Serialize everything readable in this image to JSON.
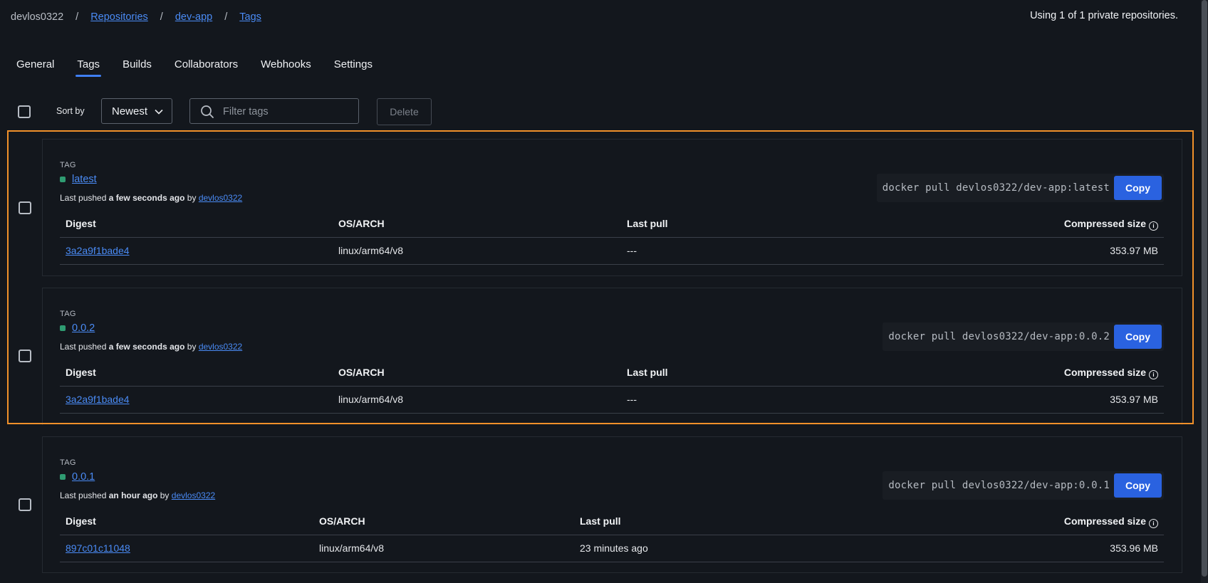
{
  "breadcrumb": {
    "user": "devlos0322",
    "repositories": "Repositories",
    "repo": "dev-app",
    "tags": "Tags",
    "separator": "/"
  },
  "usage_text": "Using 1 of 1 private repositories.",
  "tabs": [
    {
      "label": "General"
    },
    {
      "label": "Tags",
      "active": true
    },
    {
      "label": "Builds"
    },
    {
      "label": "Collaborators"
    },
    {
      "label": "Webhooks"
    },
    {
      "label": "Settings"
    }
  ],
  "toolbar": {
    "sort_label": "Sort by",
    "sort_value": "Newest",
    "filter_placeholder": "Filter tags",
    "delete_label": "Delete"
  },
  "table_headers": {
    "digest": "Digest",
    "os_arch": "OS/ARCH",
    "last_pull": "Last pull",
    "size": "Compressed size"
  },
  "tags": [
    {
      "label": "TAG",
      "name": "latest",
      "pushed_prefix": "Last pushed",
      "pushed_time": "a few seconds ago",
      "pushed_by_word": "by",
      "pushed_by": "devlos0322",
      "pull_command": "docker pull devlos0322/dev-app:latest",
      "copy_label": "Copy",
      "row": {
        "digest": "3a2a9f1bade4",
        "os_arch": "linux/arm64/v8",
        "last_pull": "---",
        "size": "353.97 MB"
      }
    },
    {
      "label": "TAG",
      "name": "0.0.2",
      "pushed_prefix": "Last pushed",
      "pushed_time": "a few seconds ago",
      "pushed_by_word": "by",
      "pushed_by": "devlos0322",
      "pull_command": "docker pull devlos0322/dev-app:0.0.2",
      "copy_label": "Copy",
      "row": {
        "digest": "3a2a9f1bade4",
        "os_arch": "linux/arm64/v8",
        "last_pull": "---",
        "size": "353.97 MB"
      }
    },
    {
      "label": "TAG",
      "name": "0.0.1",
      "pushed_prefix": "Last pushed",
      "pushed_time": "an hour ago",
      "pushed_by_word": "by",
      "pushed_by": "devlos0322",
      "pull_command": "docker pull devlos0322/dev-app:0.0.1",
      "copy_label": "Copy",
      "row": {
        "digest": "897c01c11048",
        "os_arch": "linux/arm64/v8",
        "last_pull": "23 minutes ago",
        "size": "353.96 MB"
      }
    }
  ],
  "colors": {
    "background": "#13171d",
    "link": "#4a8bf5",
    "accent": "#3f7ff2",
    "copy_button": "#2a62e0",
    "highlight": "#f0902a",
    "tag_status": "#2f9c72"
  }
}
